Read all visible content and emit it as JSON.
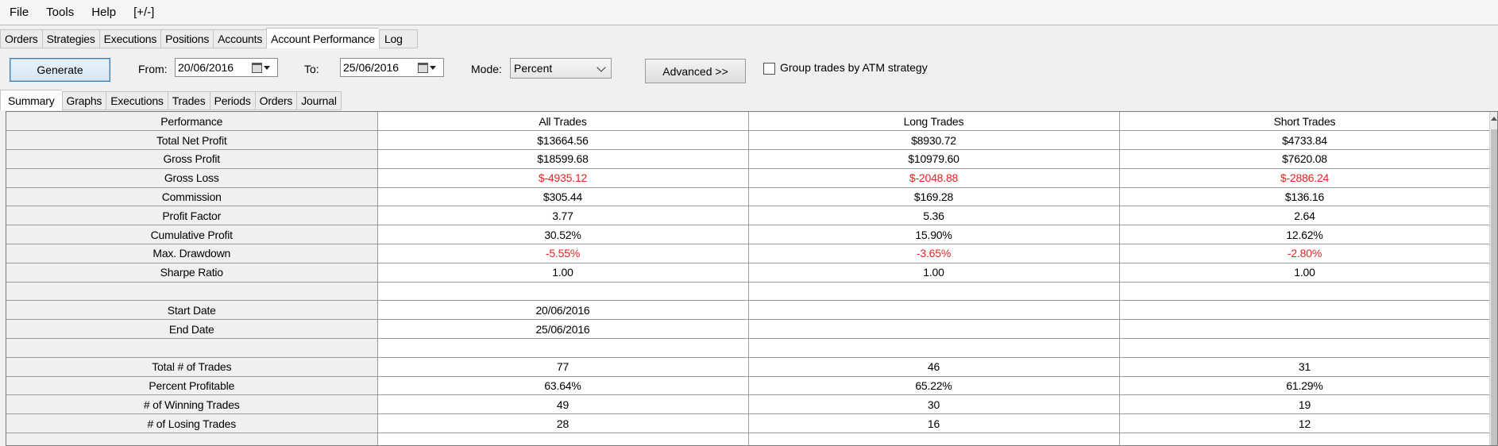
{
  "menu": [
    "File",
    "Tools",
    "Help",
    "[+/-]"
  ],
  "main_tabs": [
    "Orders",
    "Strategies",
    "Executions",
    "Positions",
    "Accounts",
    "Account Performance",
    "Log"
  ],
  "toolbar": {
    "generate_label": "Generate",
    "from_label": "From:",
    "from_value": "20/06/2016",
    "to_label": "To:",
    "to_value": "25/06/2016",
    "mode_label": "Mode:",
    "mode_value": "Percent",
    "advanced_label": "Advanced >>",
    "group_label": "Group trades by ATM strategy"
  },
  "sub_tabs": [
    "Summary",
    "Graphs",
    "Executions",
    "Trades",
    "Periods",
    "Orders",
    "Journal"
  ],
  "table": {
    "headers": [
      "Performance",
      "All Trades",
      "Long Trades",
      "Short Trades"
    ],
    "rows": [
      {
        "label": "Total Net Profit",
        "values": [
          "$13664.56",
          "$8930.72",
          "$4733.84"
        ],
        "negative": false
      },
      {
        "label": "Gross Profit",
        "values": [
          "$18599.68",
          "$10979.60",
          "$7620.08"
        ],
        "negative": false
      },
      {
        "label": "Gross Loss",
        "values": [
          "$-4935.12",
          "$-2048.88",
          "$-2886.24"
        ],
        "negative": true
      },
      {
        "label": "Commission",
        "values": [
          "$305.44",
          "$169.28",
          "$136.16"
        ],
        "negative": false
      },
      {
        "label": "Profit Factor",
        "values": [
          "3.77",
          "5.36",
          "2.64"
        ],
        "negative": false
      },
      {
        "label": "Cumulative Profit",
        "values": [
          "30.52%",
          "15.90%",
          "12.62%"
        ],
        "negative": false
      },
      {
        "label": "Max. Drawdown",
        "values": [
          "-5.55%",
          "-3.65%",
          "-2.80%"
        ],
        "negative": true
      },
      {
        "label": "Sharpe Ratio",
        "values": [
          "1.00",
          "1.00",
          "1.00"
        ],
        "negative": false
      },
      {
        "label": "",
        "values": [
          "",
          "",
          ""
        ],
        "negative": false
      },
      {
        "label": "Start Date",
        "values": [
          "20/06/2016",
          "",
          ""
        ],
        "negative": false
      },
      {
        "label": "End Date",
        "values": [
          "25/06/2016",
          "",
          ""
        ],
        "negative": false
      },
      {
        "label": "",
        "values": [
          "",
          "",
          ""
        ],
        "negative": false
      },
      {
        "label": "Total # of Trades",
        "values": [
          "77",
          "46",
          "31"
        ],
        "negative": false
      },
      {
        "label": "Percent Profitable",
        "values": [
          "63.64%",
          "65.22%",
          "61.29%"
        ],
        "negative": false
      },
      {
        "label": "# of Winning Trades",
        "values": [
          "49",
          "30",
          "19"
        ],
        "negative": false
      },
      {
        "label": "# of Losing Trades",
        "values": [
          "28",
          "16",
          "12"
        ],
        "negative": false
      },
      {
        "label": "",
        "values": [
          "",
          "",
          ""
        ],
        "negative": false
      }
    ]
  },
  "colors": {
    "negative": "#e82222",
    "generate_border": "#3c7fb1"
  },
  "icons": [
    "calendar-icon",
    "dropdown-caret-icon",
    "chevron-down-icon",
    "checkbox-icon",
    "scroll-up-arrow-icon"
  ]
}
